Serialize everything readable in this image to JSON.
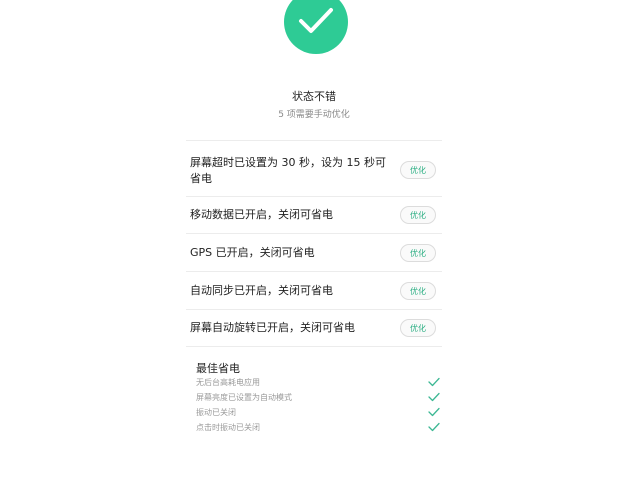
{
  "status": {
    "title": "状态不错",
    "subtitle": "5 项需要手动优化"
  },
  "optimize_items": [
    {
      "line1": "屏幕超时已设置为 30 秒，设为 15 秒可",
      "line2": "省电",
      "button": "优化"
    },
    {
      "line1": "移动数据已开启，关闭可省电",
      "button": "优化"
    },
    {
      "line1": "GPS 已开启，关闭可省电",
      "button": "优化"
    },
    {
      "line1": "自动同步已开启，关闭可省电",
      "button": "优化"
    },
    {
      "line1": "屏幕自动旋转已开启，关闭可省电",
      "button": "优化"
    }
  ],
  "best": {
    "title": "最佳省电",
    "items": [
      "无后台高耗电应用",
      "屏幕亮度已设置为自动模式",
      "振动已关闭",
      "点击时振动已关闭"
    ]
  },
  "colors": {
    "accent": "#2ecb95",
    "button_text": "#2aae82"
  },
  "icons": {
    "status": "check-icon",
    "best_item": "check-icon"
  }
}
